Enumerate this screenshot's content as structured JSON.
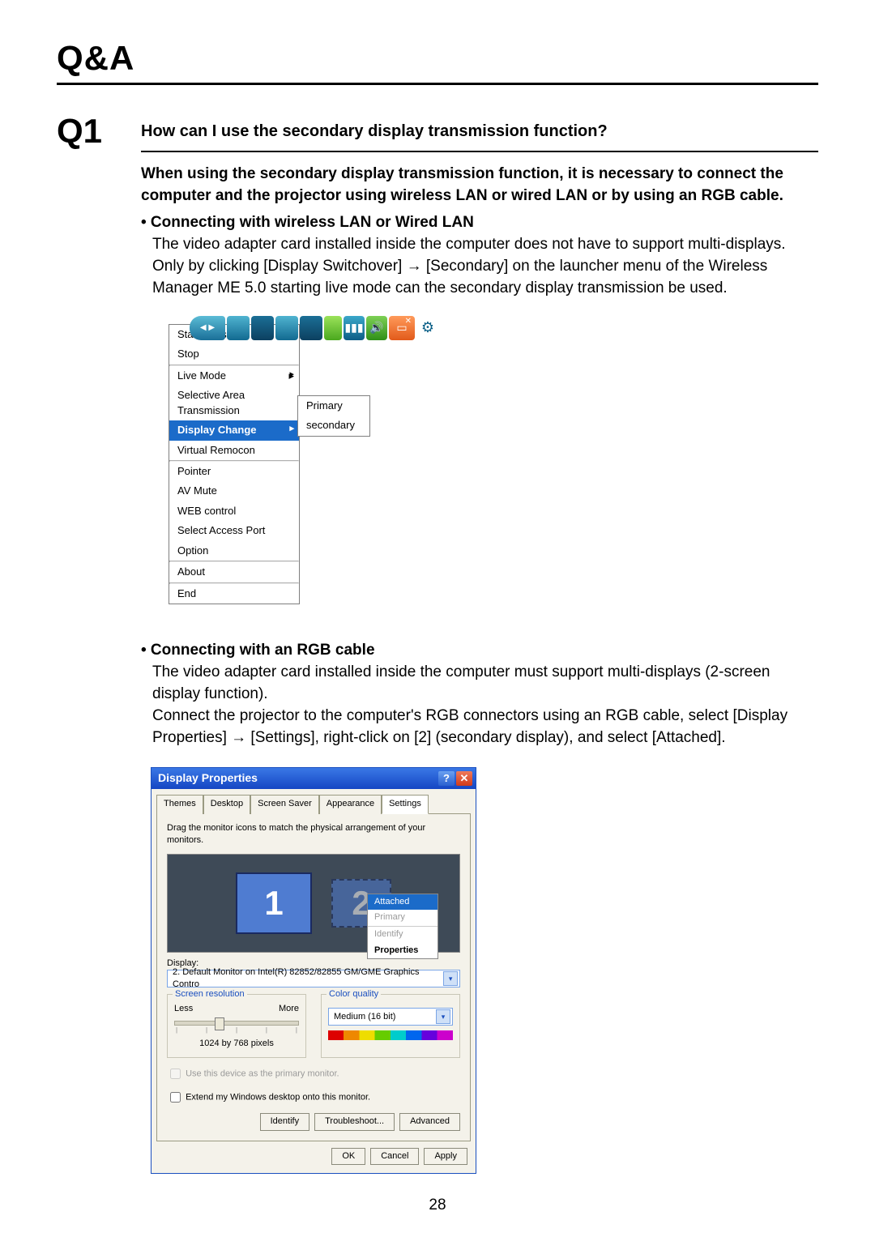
{
  "page": {
    "title": "Q&A",
    "number": "28"
  },
  "q1": {
    "num": "Q1",
    "question": "How can I use the secondary display transmission function?",
    "intro": "When using the secondary display transmission function, it is necessary to connect the computer and the projector using wireless LAN or wired LAN or by using an RGB cable.",
    "sec_a_title": "• Connecting  with wireless LAN or Wired LAN",
    "sec_a_p1": "The video adapter card installed inside the computer does not have to support multi-displays.",
    "sec_a_p2": "Only by clicking [Display Switchover] → [Secondary] on the launcher menu of the Wireless Manager ME 5.0 starting live mode can the secondary display transmission be used.",
    "sec_b_title": "• Connecting with an RGB cable",
    "sec_b_p1": "The video adapter card installed inside the computer must support multi-displays (2-screen display function).",
    "sec_b_p2": "Connect the projector to the computer's RGB connectors using an RGB cable, select [Display Properties] → [Settings], right-click on [2] (secondary display), and select [Attached]."
  },
  "launcher_menu": {
    "items_g1": [
      "Start/Pause",
      "Stop"
    ],
    "items_g2": [
      "Live Mode",
      "Selective Area Transmission"
    ],
    "highlight": "Display Change",
    "after_hl": "Virtual Remocon",
    "items_g3": [
      "Pointer",
      "AV Mute",
      "WEB control",
      "Select Access Port",
      "Option"
    ],
    "items_g4": [
      "About"
    ],
    "items_g5": [
      "End"
    ],
    "submenu": [
      "Primary",
      "secondary"
    ]
  },
  "dialog": {
    "title": "Display Properties",
    "tabs": [
      "Themes",
      "Desktop",
      "Screen Saver",
      "Appearance",
      "Settings"
    ],
    "active_tab": "Settings",
    "drag_text": "Drag the monitor icons to match the physical arrangement of your monitors.",
    "mon1": "1",
    "mon2": "2",
    "ctx": {
      "attached": "Attached",
      "primary": "Primary",
      "identify": "Identify",
      "properties": "Properties"
    },
    "display_label": "Display:",
    "display_value": "2. Default Monitor on Intel(R) 82852/82855 GM/GME Graphics Contro",
    "res_title": "Screen resolution",
    "res_less": "Less",
    "res_more": "More",
    "res_value": "1024 by 768 pixels",
    "cq_title": "Color quality",
    "cq_value": "Medium (16 bit)",
    "chk1": "Use this device as the primary monitor.",
    "chk2": "Extend my Windows desktop onto this monitor.",
    "btn_identify": "Identify",
    "btn_trouble": "Troubleshoot...",
    "btn_adv": "Advanced",
    "btn_ok": "OK",
    "btn_cancel": "Cancel",
    "btn_apply": "Apply"
  }
}
